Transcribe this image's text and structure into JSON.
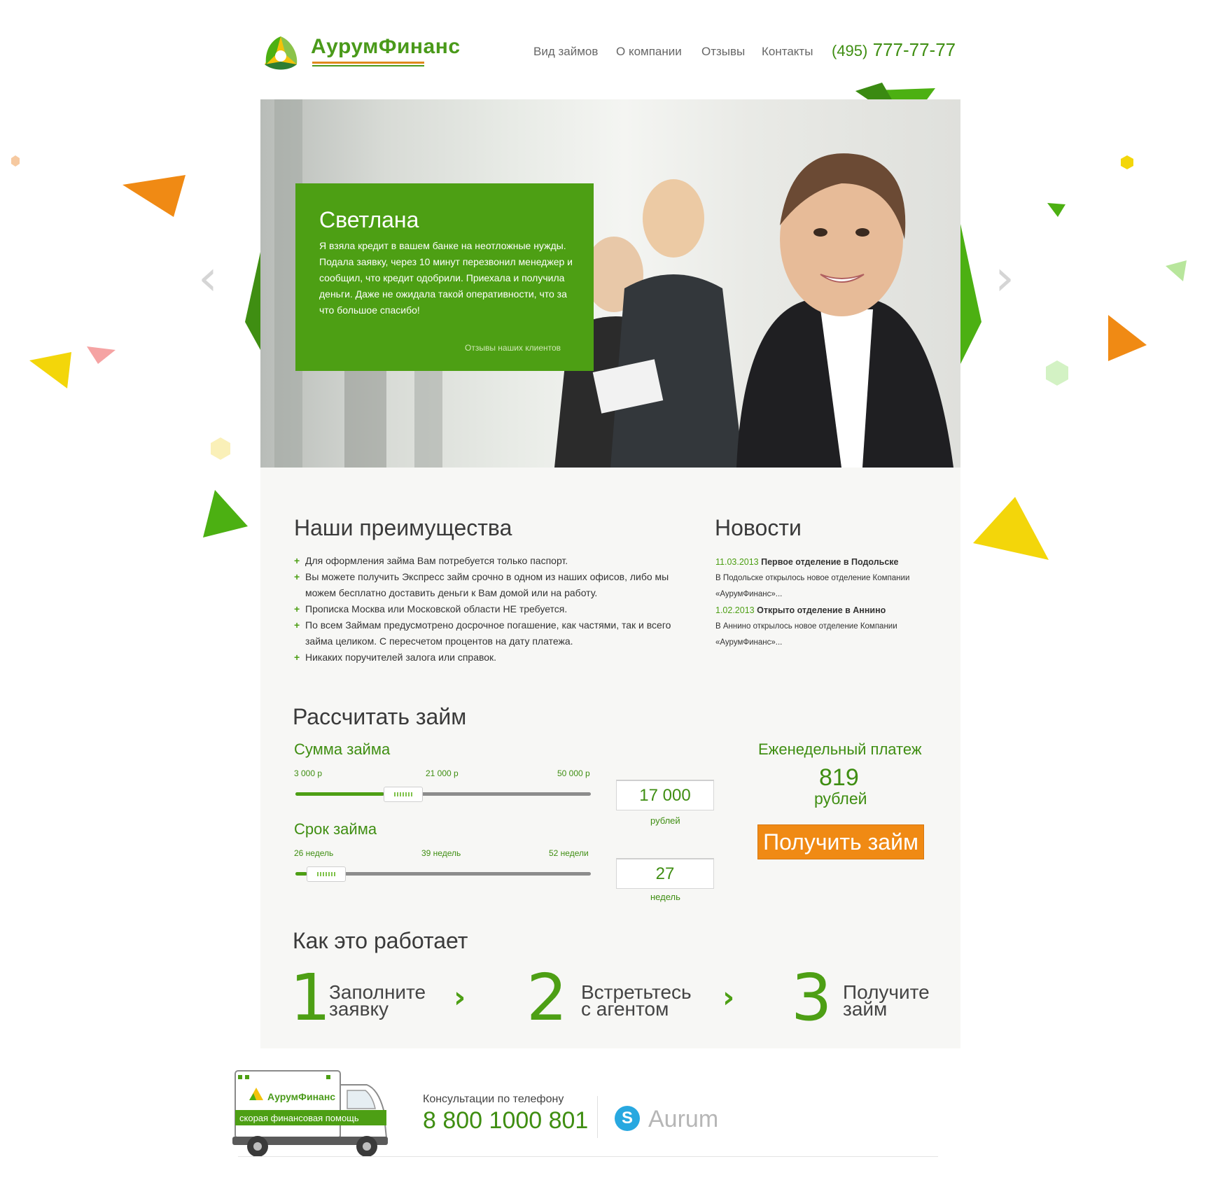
{
  "header": {
    "logo_text": "АурумФинанс",
    "nav": [
      "Вид займов",
      "О компании",
      "Отзывы",
      "Контакты"
    ],
    "phone_code": "(495)",
    "phone_number": "777-77-77"
  },
  "hero": {
    "testimonial_name": "Светлана",
    "testimonial_text": "Я взяла кредит в вашем банке на неотложные нужды. Подала заявку, через 10 минут перезвонил менеджер и сообщил, что кредит одобрили. Приехала и получила деньги. Даже не ожидала такой оперативности, что за что большое спасибо!",
    "testimonial_link": "Отзывы наших клиентов",
    "prev_glyph": "‹",
    "next_glyph": "›"
  },
  "advantages": {
    "title": "Наши преимущества",
    "items": [
      "Для оформления займа Вам потребуется только паспорт.",
      "Вы можете получить Экспресс займ срочно в одном из наших офисов, либо мы можем бесплатно доставить деньги к Вам домой или на работу.",
      "Прописка Москва или Московской области НЕ требуется.",
      "По всем Займам предусмотрено досрочное погашение, как частями, так и всего займа целиком. С пересчетом процентов на дату платежа.",
      "Никаких поручителей залога или справок."
    ]
  },
  "news": {
    "title": "Новости",
    "items": [
      {
        "date": "11.03.2013",
        "headline": "Первое отделение в Подольске",
        "text": "В Подольске открылось новое отделение Компании «АурумФинанс»..."
      },
      {
        "date": "1.02.2013",
        "headline": "Открыто отделение в Аннино",
        "text": "В Аннино открылось новое отделение Компании «АурумФинанс»..."
      }
    ]
  },
  "calculator": {
    "title": "Рассчитать займ",
    "amount": {
      "label": "Сумма займа",
      "ticks": [
        "3 000 р",
        "21 000 р",
        "50 000 р"
      ],
      "min": 3000,
      "max": 50000,
      "value": 17000,
      "value_text": "17 000",
      "unit": "рублей"
    },
    "term": {
      "label": "Срок займа",
      "ticks": [
        "26 недель",
        "39 недель",
        "52 недели"
      ],
      "min": 26,
      "max": 52,
      "value": 27,
      "value_text": "27",
      "unit": "недель"
    },
    "payment": {
      "label": "Еженедельный платеж",
      "value": "819",
      "unit": "рублей"
    },
    "button": "Получить займ"
  },
  "how": {
    "title": "Как это работает",
    "steps": [
      {
        "num": "1",
        "line1": "Заполните",
        "line2": "заявку"
      },
      {
        "num": "2",
        "line1": "Встретьтесь",
        "line2": "с агентом"
      },
      {
        "num": "3",
        "line1": "Получите",
        "line2": "займ"
      }
    ],
    "arrow_glyph": "›"
  },
  "footer": {
    "van_logo": "АурумФинанс",
    "van_slogan": "скорая  финансовая  помощь",
    "consult_label": "Консультации по телефону",
    "phone": "8 800 1000 801",
    "skype_letter": "S",
    "skype": "Aurum"
  },
  "colors": {
    "brand_green": "#4d9f14",
    "accent_orange": "#f08a14",
    "accent_yellow": "#f3d60a"
  }
}
